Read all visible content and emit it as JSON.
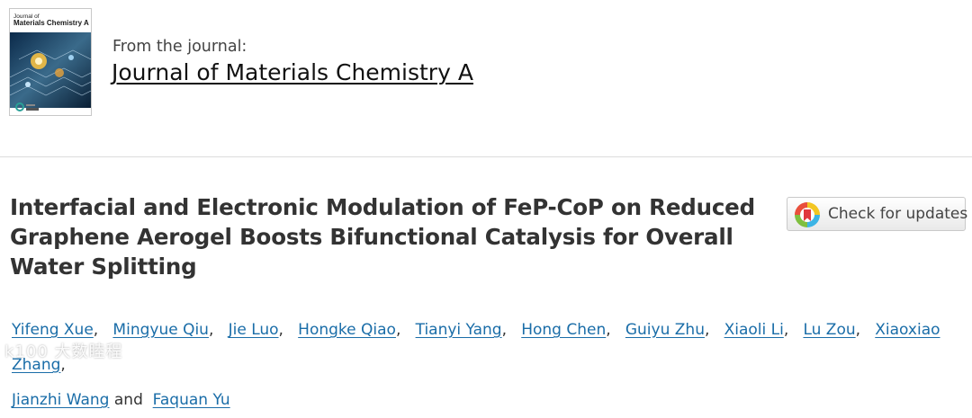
{
  "journal": {
    "cover_title_line1": "Journal of",
    "cover_title_line2": "Materials Chemistry A",
    "from_label": "From the journal:",
    "name": "Journal of Materials Chemistry A"
  },
  "article": {
    "title": "Interfacial and Electronic Modulation of FeP-CoP on Reduced Graphene Aerogel Boosts Bifunctional Catalysis for Overall Water Splitting",
    "check_updates_label": "Check for updates",
    "authors": [
      "Yifeng Xue",
      "Mingyue Qiu",
      "Jie Luo",
      "Hongke Qiao",
      "Tianyi Yang",
      "Hong Chen",
      "Guiyu Zhu",
      "Xiaoli Li",
      "Lu Zou",
      "Xiaoxiao Zhang",
      "Jianzhi Wang",
      "Faquan Yu"
    ],
    "and_word": "and"
  },
  "watermark": "k100 大数睦程",
  "colors": {
    "link": "#1a6da8",
    "title": "#333333",
    "divider": "#dcdcdc"
  }
}
